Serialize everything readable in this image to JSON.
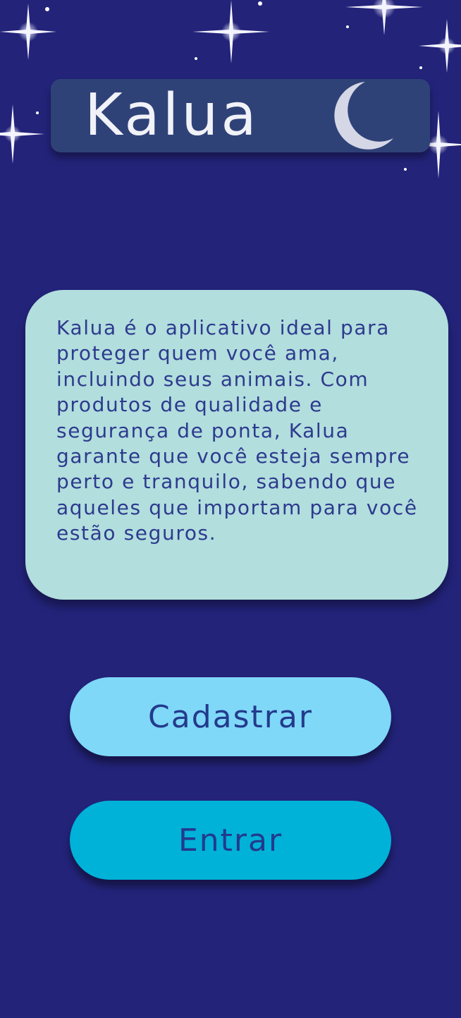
{
  "app": {
    "logo_text": "Kalua",
    "logo_icon": "crescent-moon-icon",
    "description": "Kalua é o aplicativo ideal para proteger quem você ama, incluindo seus animais. Com produtos de qualidade e segurança de ponta, Kalua garante que você esteja sempre perto e tranquilo, sabendo que aqueles que importam para você estão seguros."
  },
  "buttons": {
    "register_label": "Cadastrar",
    "login_label": "Entrar"
  },
  "colors": {
    "background": "#23237a",
    "logo_box": "#2f4278",
    "card": "#b2dedd",
    "text_dark": "#2d3a8e",
    "register_button": "#7fd8f8",
    "login_button": "#00b1d8"
  }
}
